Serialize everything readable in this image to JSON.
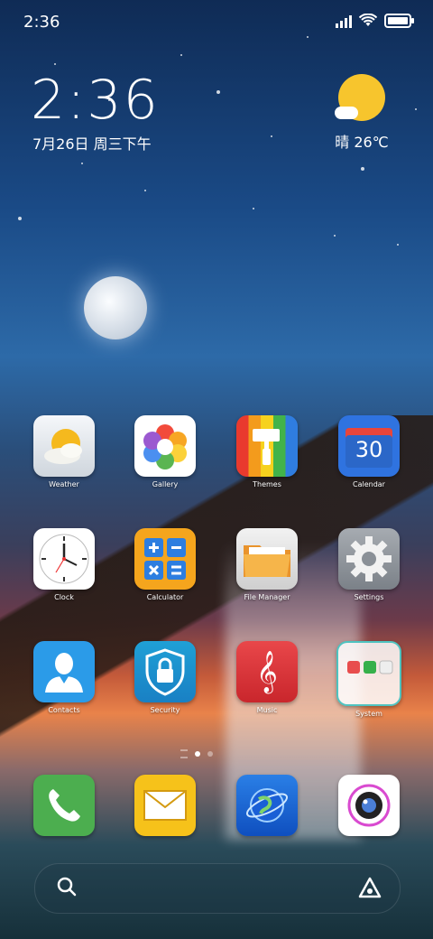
{
  "status_bar": {
    "time": "2:36",
    "icons": [
      "signal-icon",
      "wifi-icon",
      "battery-icon"
    ],
    "battery_level": 0.85
  },
  "lock_widget": {
    "time": "2:36",
    "date": "7月26日 周三下午",
    "weather": "晴 26℃",
    "weather_icon": "sunny-icon"
  },
  "apps": [
    {
      "id": "weather",
      "label": "Weather",
      "icon": "weather-icon"
    },
    {
      "id": "gallery",
      "label": "Gallery",
      "icon": "gallery-icon"
    },
    {
      "id": "themes",
      "label": "Themes",
      "icon": "themes-icon"
    },
    {
      "id": "calendar",
      "label": "Calendar",
      "icon": "calendar-icon",
      "badge_text": "30"
    },
    {
      "id": "clock",
      "label": "Clock",
      "icon": "clock-icon"
    },
    {
      "id": "calculator",
      "label": "Calculator",
      "icon": "calculator-icon"
    },
    {
      "id": "file-manager",
      "label": "File Manager",
      "icon": "folder-icon"
    },
    {
      "id": "settings",
      "label": "Settings",
      "icon": "gear-icon"
    },
    {
      "id": "contacts",
      "label": "Contacts",
      "icon": "contacts-icon"
    },
    {
      "id": "security",
      "label": "Security",
      "icon": "shield-lock-icon"
    },
    {
      "id": "music",
      "label": "Music",
      "icon": "music-icon"
    },
    {
      "id": "system",
      "label": "System",
      "icon": "folder-icon"
    }
  ],
  "dock": [
    {
      "id": "phone",
      "icon": "phone-icon"
    },
    {
      "id": "messages",
      "icon": "mail-icon"
    },
    {
      "id": "browser",
      "icon": "globe-icon"
    },
    {
      "id": "camera",
      "icon": "camera-icon"
    }
  ],
  "page_indicator": {
    "pages": 2,
    "current": 1
  },
  "search_bar": {
    "left_icon": "search-icon",
    "right_icon": "assistant-icon"
  },
  "colors": {
    "accent_sun": "#f7c52d",
    "phone_green": "#4cae4f",
    "mail_yellow": "#f6c21a"
  }
}
